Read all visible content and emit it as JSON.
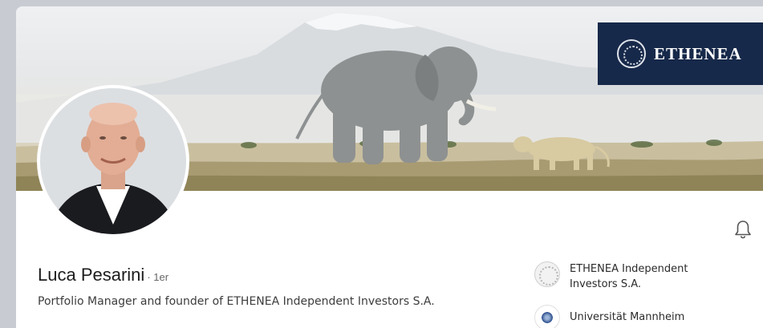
{
  "banner": {
    "brand_name": "ETHENEA",
    "brand_bg_color": "#17294a"
  },
  "profile": {
    "name": "Luca Pesarini",
    "connection_degree": "· 1er",
    "headline": "Portfolio Manager and founder of ETHENEA Independent Investors S.A."
  },
  "organizations": [
    {
      "name": "ETHENEA Independent Investors S.A.",
      "icon": "ethenea-logo"
    },
    {
      "name": "Universität Mannheim",
      "icon": "university-seal"
    }
  ],
  "actions": {
    "bell_icon": "bell-icon"
  }
}
